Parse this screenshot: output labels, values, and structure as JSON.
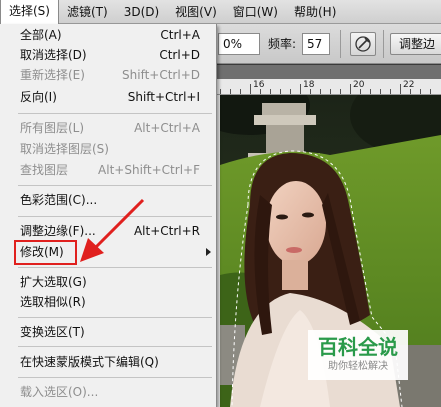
{
  "menubar": {
    "items": [
      "选择(S)",
      "滤镜(T)",
      "3D(D)",
      "视图(V)",
      "窗口(W)",
      "帮助(H)"
    ]
  },
  "options": {
    "value1": "0%",
    "freq_label": "频率:",
    "freq_value": "57",
    "refine_edge": "调整边"
  },
  "ruler": {
    "labels": [
      "16",
      "18",
      "20",
      "22"
    ]
  },
  "select_menu": {
    "items": [
      {
        "label": "全部(A)",
        "shortcut": "Ctrl+A",
        "enabled": true
      },
      {
        "label": "取消选择(D)",
        "shortcut": "Ctrl+D",
        "enabled": true
      },
      {
        "label": "重新选择(E)",
        "shortcut": "Shift+Ctrl+D",
        "enabled": false
      },
      {
        "label": "反向(I)",
        "shortcut": "Shift+Ctrl+I",
        "enabled": true
      },
      {
        "label": "所有图层(L)",
        "shortcut": "Alt+Ctrl+A",
        "enabled": false
      },
      {
        "label": "取消选择图层(S)",
        "shortcut": "",
        "enabled": false
      },
      {
        "label": "查找图层",
        "shortcut": "Alt+Shift+Ctrl+F",
        "enabled": false
      },
      {
        "label": "色彩范围(C)...",
        "shortcut": "",
        "enabled": true
      },
      {
        "label": "调整边缘(F)...",
        "shortcut": "Alt+Ctrl+R",
        "enabled": true
      },
      {
        "label": "修改(M)",
        "shortcut": "",
        "enabled": true,
        "submenu": true
      },
      {
        "label": "扩大选取(G)",
        "shortcut": "",
        "enabled": true
      },
      {
        "label": "选取相似(R)",
        "shortcut": "",
        "enabled": true
      },
      {
        "label": "变换选区(T)",
        "shortcut": "",
        "enabled": true
      },
      {
        "label": "在快速蒙版模式下编辑(Q)",
        "shortcut": "",
        "enabled": true
      },
      {
        "label": "载入选区(O)...",
        "shortcut": "",
        "enabled": false
      }
    ]
  },
  "watermark": {
    "title": "百科全说",
    "subtitle": "助你轻松解决"
  },
  "colors": {
    "highlight_red": "#e0201e",
    "watermark_green": "#2a9a4a"
  }
}
